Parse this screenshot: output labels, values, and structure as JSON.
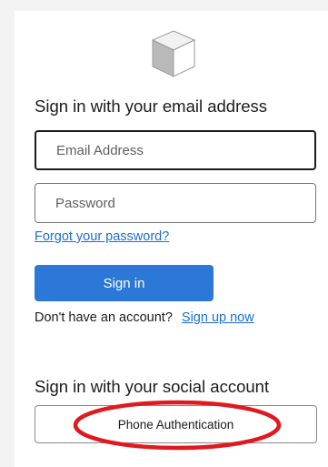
{
  "heading_email": "Sign in with your email address",
  "email_field": {
    "value": "",
    "placeholder": "Email Address"
  },
  "password_field": {
    "value": "",
    "placeholder": "Password"
  },
  "forgot_link": "Forgot your password?",
  "sign_in_button": "Sign in",
  "no_account_text": "Don't have an account?",
  "sign_up_link": "Sign up now",
  "heading_social": "Sign in with your social account",
  "social_buttons": [
    {
      "label": "Phone Authentication"
    }
  ],
  "logo_icon": "cube-icon",
  "annotation": {
    "shape": "ellipse",
    "color": "#e0191f"
  },
  "colors": {
    "primary": "#2b78d6",
    "link": "#1a6ed6",
    "annotation": "#e0191f"
  }
}
